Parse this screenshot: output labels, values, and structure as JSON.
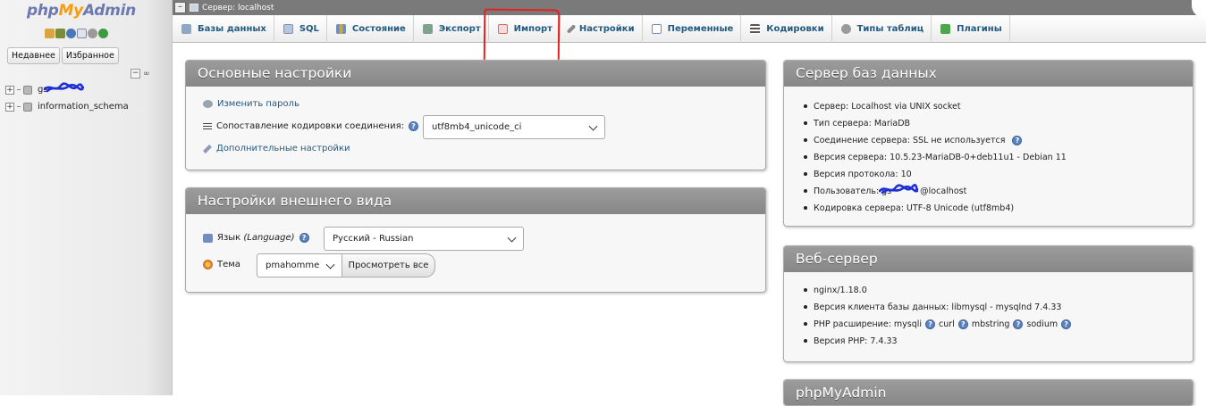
{
  "nav": {
    "logo": {
      "php": "php",
      "my": "My",
      "admin": "Admin"
    },
    "icons": [
      "home-icon",
      "db-icon",
      "help-icon",
      "doc-icon",
      "settings-icon",
      "reload-icon"
    ],
    "tabs": [
      "Недавнее",
      "Избранное"
    ],
    "databases": [
      {
        "name": "gs",
        "redacted": true
      },
      {
        "name": "information_schema",
        "redacted": false
      }
    ]
  },
  "topbar": {
    "title": "Сервер: localhost"
  },
  "tabs": [
    {
      "label": "Базы данных",
      "icon": "databases-icon",
      "color": "#8fa7c6"
    },
    {
      "label": "SQL",
      "icon": "sql-icon",
      "color": "#b5c6df"
    },
    {
      "label": "Состояние",
      "icon": "status-icon",
      "color": "#6d8fbd"
    },
    {
      "label": "Экспорт",
      "icon": "export-icon",
      "color": "#7ea38d"
    },
    {
      "label": "Импорт",
      "icon": "import-icon",
      "color": "#d86b60"
    },
    {
      "label": "Настройки",
      "icon": "wrench-icon",
      "color": "#8a8a8a"
    },
    {
      "label": "Переменные",
      "icon": "variables-icon",
      "color": "#6d8fbd"
    },
    {
      "label": "Кодировки",
      "icon": "charsets-icon",
      "color": "#555555"
    },
    {
      "label": "Типы таблиц",
      "icon": "engines-icon",
      "color": "#9a9a9a"
    },
    {
      "label": "Плагины",
      "icon": "plugins-icon",
      "color": "#4ca64c"
    }
  ],
  "general": {
    "title": "Основные настройки",
    "change_password": "Изменить пароль",
    "collation_label": "Сопоставление кодировки соединения:",
    "collation_value": "utf8mb4_unicode_ci",
    "more_settings": "Дополнительные настройки"
  },
  "appearance": {
    "title": "Настройки внешнего вида",
    "language_label": "Язык",
    "language_label_em": "(Language)",
    "language_value": "Русский - Russian",
    "theme_label": "Тема",
    "theme_value": "pmahomme",
    "view_all": "Просмотреть все"
  },
  "db_server": {
    "title": "Сервер баз данных",
    "items": [
      "Сервер: Localhost via UNIX socket",
      "Тип сервера: MariaDB",
      "Соединение сервера: SSL не используется",
      "Версия сервера: 10.5.23-MariaDB-0+deb11u1 - Debian 11",
      "Версия протокола: 10",
      "Пользователь: gs",
      "Кодировка сервера: UTF-8 Unicode (utf8mb4)"
    ],
    "user_suffix": "@localhost"
  },
  "web_server": {
    "title": "Веб-сервер",
    "items": [
      "nginx/1.18.0",
      "Версия клиента базы данных: libmysql - mysqlnd 7.4.33",
      "Версия PHP: 7.4.33"
    ],
    "php_ext_label": "PHP расширение: mysqli",
    "php_ext": [
      "curl",
      "mbstring",
      "sodium"
    ]
  },
  "pma": {
    "title": "phpMyAdmin"
  }
}
